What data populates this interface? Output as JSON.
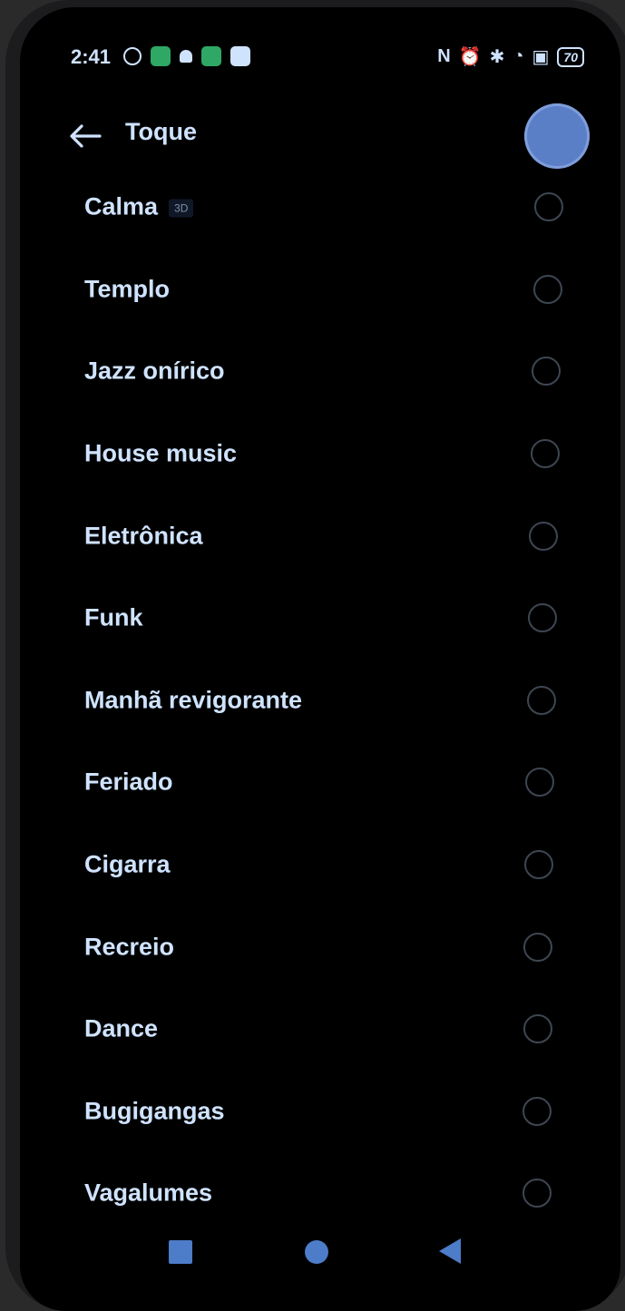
{
  "status_bar": {
    "time": "2:41",
    "battery": "70",
    "left_icons": [
      "settings-gear-icon",
      "green-grid-app-icon",
      "android-icon",
      "green-app-icon",
      "message-icon"
    ],
    "right_icons": [
      "nfc-icon",
      "alarm-icon",
      "bluetooth-icon",
      "wifi-icon",
      "sim-icon"
    ]
  },
  "header": {
    "title": "Toque",
    "back_icon": "arrow-left-icon",
    "accent": "#5b7fc7"
  },
  "ringtones": [
    {
      "label": "Calma",
      "badge": "3D",
      "selected": false
    },
    {
      "label": "Templo",
      "selected": false
    },
    {
      "label": "Jazz onírico",
      "selected": false
    },
    {
      "label": "House music",
      "selected": false
    },
    {
      "label": "Eletrônica",
      "selected": false
    },
    {
      "label": "Funk",
      "selected": false
    },
    {
      "label": "Manhã revigorante",
      "selected": false
    },
    {
      "label": "Feriado",
      "selected": false
    },
    {
      "label": "Cigarra",
      "selected": false
    },
    {
      "label": "Recreio",
      "selected": false
    },
    {
      "label": "Dance",
      "selected": false
    },
    {
      "label": "Bugigangas",
      "selected": false
    },
    {
      "label": "Vagalumes",
      "selected": false
    }
  ],
  "colors": {
    "text": "#cfe3ff",
    "background": "#000000",
    "nav": "#4d7cc9",
    "radio_border": "#3e4652"
  }
}
